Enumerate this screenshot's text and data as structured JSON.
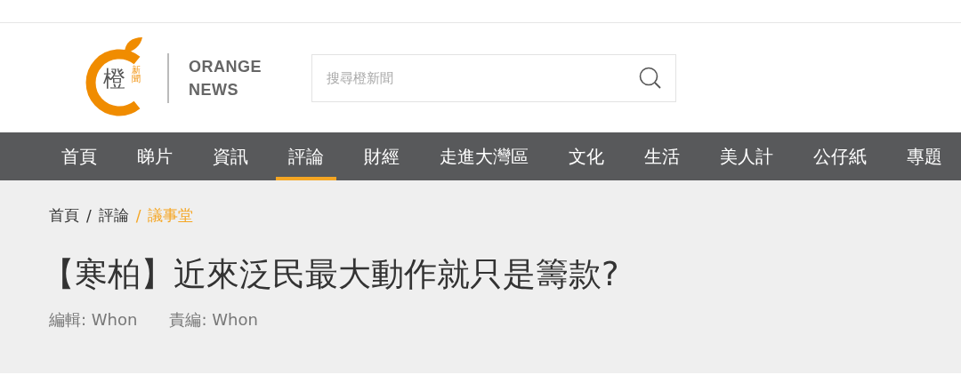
{
  "logo": {
    "mark": "橙",
    "mark_small": "新聞",
    "wordmark_lines": [
      "ORANGE",
      "NEWS"
    ]
  },
  "search": {
    "placeholder": "搜尋橙新聞"
  },
  "nav": [
    {
      "label": "首頁",
      "selected": false
    },
    {
      "label": "睇片",
      "selected": false
    },
    {
      "label": "資訊",
      "selected": false
    },
    {
      "label": "評論",
      "selected": true
    },
    {
      "label": "財經",
      "selected": false
    },
    {
      "label": "走進大灣區",
      "selected": false
    },
    {
      "label": "文化",
      "selected": false
    },
    {
      "label": "生活",
      "selected": false
    },
    {
      "label": "美人計",
      "selected": false
    },
    {
      "label": "公仔紙",
      "selected": false
    },
    {
      "label": "專題",
      "selected": false
    }
  ],
  "breadcrumb": [
    {
      "label": "首頁",
      "selected": false
    },
    {
      "label": "評論",
      "selected": false
    },
    {
      "label": "議事堂",
      "selected": true
    }
  ],
  "breadcrumb_separator": "/",
  "article": {
    "title": "【寒柏】近來泛民最大動作就只是籌款?",
    "meta": [
      {
        "label": "編輯:",
        "value": "Whon"
      },
      {
        "label": "責編:",
        "value": "Whon"
      }
    ]
  }
}
